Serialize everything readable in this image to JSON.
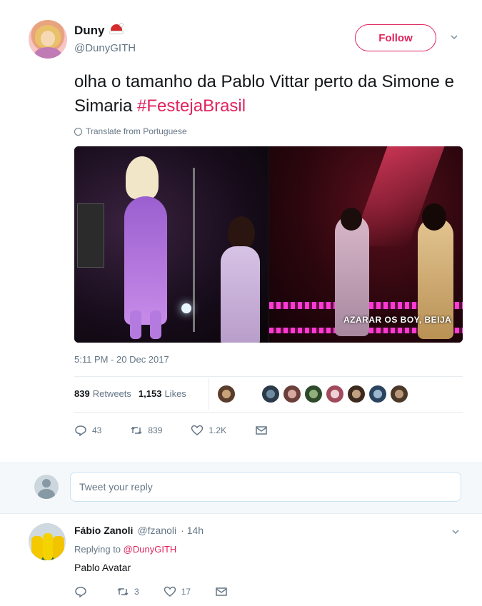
{
  "tweet": {
    "author_name": "Duny",
    "author_handle": "@DunyGITH",
    "follow_label": "Follow",
    "text_main": "olha o tamanho da Pablo Vittar perto da Simone e Simaria ",
    "hashtag": "#FestejaBrasil",
    "translate_label": "Translate from Portuguese",
    "media_caption": "AZARAR OS BOY, BEIJA",
    "timestamp": "5:11 PM - 20 Dec 2017",
    "retweets_count": "839",
    "retweets_label": "Retweets",
    "likes_count": "1,153",
    "likes_label": "Likes",
    "actions": {
      "replies": "43",
      "retweets": "839",
      "likes": "1.2K"
    }
  },
  "reply_box": {
    "placeholder": "Tweet your reply"
  },
  "reply": {
    "author_name": "Fábio Zanoli",
    "author_handle": "@fzanoli",
    "time": "· 14h",
    "replying_prefix": "Replying to",
    "replying_to": "@DunyGITH",
    "text": "Pablo Avatar",
    "actions": {
      "replies": "",
      "retweets": "3",
      "likes": "17"
    }
  },
  "colors": {
    "accent": "#e0245e",
    "secondary_text": "#657786",
    "divider": "#e6ecf0"
  },
  "icons": {
    "reply": "reply-icon",
    "retweet": "retweet-icon",
    "like": "heart-icon",
    "dm": "envelope-icon",
    "more": "chevron-down-icon",
    "translate": "globe-icon"
  }
}
